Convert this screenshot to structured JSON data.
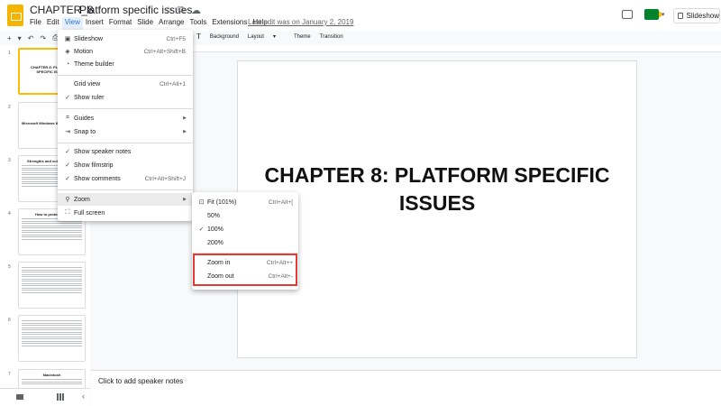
{
  "header": {
    "doc_name": "CHAPTER_8",
    "doc_title": "Platform specific issues",
    "last_edit": "Last edit was on January 2, 2019",
    "slideshow_label": "Slideshow",
    "star_glyph": "☆",
    "move_glyph": "⧉",
    "cloud_glyph": "☁",
    "meet_caret": "▾"
  },
  "menubar": [
    "File",
    "Edit",
    "View",
    "Insert",
    "Format",
    "Slide",
    "Arrange",
    "Tools",
    "Extensions",
    "Help"
  ],
  "toolbar": {
    "left_glyphs": [
      "+",
      "▾",
      "↶",
      "↷",
      "⎙"
    ],
    "text_tool": "ꓔ",
    "background": "Background",
    "layout": "Layout",
    "layout_caret": "▾",
    "theme": "Theme",
    "transition": "Transition"
  },
  "view_menu": {
    "items": [
      {
        "label": "Slideshow",
        "shortcut": "Ctrl+F5",
        "icon": "slideshow-icon",
        "glyph": "▣"
      },
      {
        "label": "Motion",
        "shortcut": "Ctrl+Alt+Shift+B",
        "icon": "motion-icon",
        "glyph": "◈"
      },
      {
        "label": "Theme builder",
        "shortcut": "",
        "icon": "palette-icon",
        "glyph": "◔"
      },
      {
        "label": "Grid view",
        "shortcut": "Ctrl+Alt+1",
        "icon": "",
        "glyph": ""
      },
      {
        "label": "Show ruler",
        "shortcut": "",
        "icon": "check-icon",
        "glyph": "✓"
      },
      {
        "label": "Guides",
        "shortcut": "",
        "icon": "guides-icon",
        "glyph": "⌗"
      },
      {
        "label": "Snap to",
        "shortcut": "",
        "icon": "snap-icon",
        "glyph": "⇥"
      },
      {
        "label": "Show speaker notes",
        "shortcut": "",
        "icon": "check-icon",
        "glyph": "✓"
      },
      {
        "label": "Show filmstrip",
        "shortcut": "",
        "icon": "check-icon",
        "glyph": "✓"
      },
      {
        "label": "Show comments",
        "shortcut": "Ctrl+Alt+Shift+J",
        "icon": "check-icon",
        "glyph": "✓"
      },
      {
        "label": "Zoom",
        "shortcut": "",
        "icon": "zoom-icon",
        "glyph": "⚲"
      },
      {
        "label": "Full screen",
        "shortcut": "",
        "icon": "fullscreen-icon",
        "glyph": "⛶"
      }
    ],
    "arrow": "▶"
  },
  "zoom_menu": {
    "items": [
      {
        "label": "Fit (101%)",
        "shortcut": "Ctrl+Alt+[",
        "glyph": "⊡"
      },
      {
        "label": "50%",
        "shortcut": "",
        "glyph": ""
      },
      {
        "label": "100%",
        "shortcut": "",
        "glyph": "✓"
      },
      {
        "label": "200%",
        "shortcut": "",
        "glyph": ""
      },
      {
        "label": "Zoom in",
        "shortcut": "Ctrl+Alt++",
        "glyph": ""
      },
      {
        "label": "Zoom out",
        "shortcut": "Ctrl+Alt+-",
        "glyph": ""
      }
    ]
  },
  "filmstrip": {
    "slides": [
      {
        "num": "1",
        "title": "CHAPTER 8: PLATFORM SPECIFIC ISSUES"
      },
      {
        "num": "2",
        "title": "Microsoft Windows 8"
      },
      {
        "num": "3",
        "title": "Strengths and vulnerabilities"
      },
      {
        "num": "4",
        "title": "How to protect yo..."
      },
      {
        "num": "5",
        "title": ""
      },
      {
        "num": "6",
        "title": ""
      },
      {
        "num": "7",
        "title": "Macintosh"
      }
    ]
  },
  "slide": {
    "title": "CHAPTER 8: PLATFORM SPECIFIC ISSUES"
  },
  "notes": {
    "placeholder": "Click to add speaker notes"
  },
  "bottom": {
    "collapse_glyph": "‹"
  }
}
